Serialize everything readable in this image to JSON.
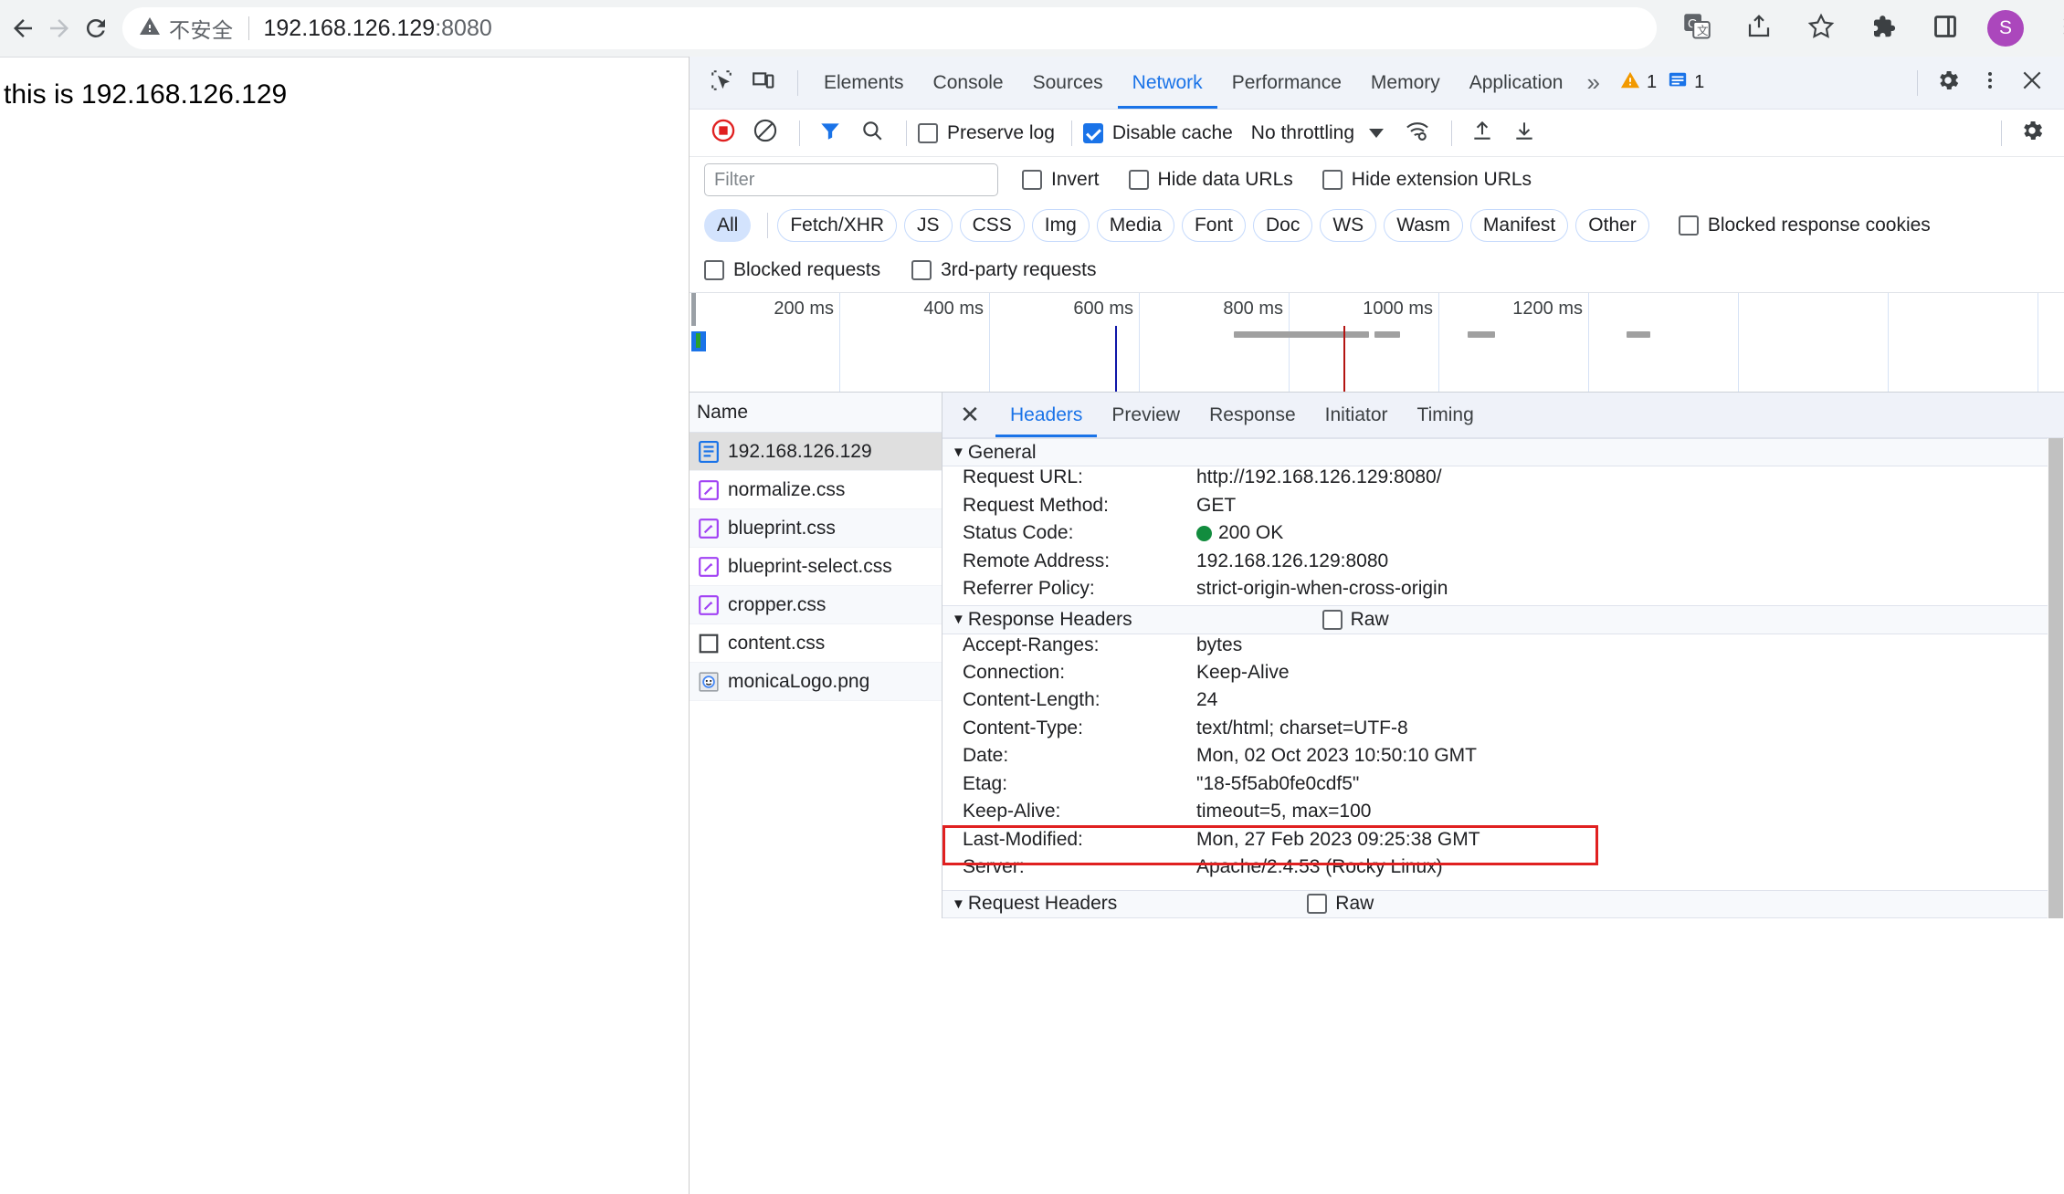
{
  "browser": {
    "back_icon": "back-arrow-icon",
    "forward_icon": "forward-arrow-icon",
    "reload_icon": "reload-icon",
    "security_label": "不安全",
    "url": "192.168.126.129",
    "url_port": ":8080",
    "actions": [
      "translate-icon",
      "share-icon",
      "bookmark-star-icon",
      "extensions-puzzle-icon",
      "side-panel-icon"
    ],
    "profile_initial": "S",
    "menu_icon": "three-dot-menu-icon"
  },
  "page": {
    "body_text": "this is 192.168.126.129"
  },
  "devtools": {
    "inspect_icon": "inspect-element-icon",
    "device_icon": "device-toolbar-icon",
    "tabs": [
      {
        "label": "Elements",
        "active": false
      },
      {
        "label": "Console",
        "active": false
      },
      {
        "label": "Sources",
        "active": false
      },
      {
        "label": "Network",
        "active": true
      },
      {
        "label": "Performance",
        "active": false
      },
      {
        "label": "Memory",
        "active": false
      },
      {
        "label": "Application",
        "active": false
      }
    ],
    "more_tabs": "»",
    "warning_count": "1",
    "message_count": "1",
    "settings_icon": "gear-icon",
    "dots_icon": "three-dot-menu-icon",
    "close_icon": "close-icon",
    "network_toolbar": {
      "record_icon": "record-stop-icon",
      "clear_icon": "clear-icon",
      "filter_icon": "filter-funnel-icon",
      "search_icon": "search-icon",
      "preserve_log": "Preserve log",
      "preserve_log_checked": false,
      "disable_cache": "Disable cache",
      "disable_cache_checked": true,
      "throttling": "No throttling",
      "wifi_icon": "network-conditions-icon",
      "import_icon": "import-har-icon",
      "export_icon": "export-har-icon",
      "settings_icon": "gear-icon"
    },
    "filter": {
      "placeholder": "Filter",
      "value": "",
      "invert": "Invert",
      "hide_data_urls": "Hide data URLs",
      "hide_extension_urls": "Hide extension URLs"
    },
    "type_filters": [
      {
        "label": "All",
        "selected": true
      },
      {
        "label": "Fetch/XHR",
        "selected": false
      },
      {
        "label": "JS",
        "selected": false
      },
      {
        "label": "CSS",
        "selected": false
      },
      {
        "label": "Img",
        "selected": false
      },
      {
        "label": "Media",
        "selected": false
      },
      {
        "label": "Font",
        "selected": false
      },
      {
        "label": "Doc",
        "selected": false
      },
      {
        "label": "WS",
        "selected": false
      },
      {
        "label": "Wasm",
        "selected": false
      },
      {
        "label": "Manifest",
        "selected": false
      },
      {
        "label": "Other",
        "selected": false
      }
    ],
    "blocked_response_cookies": "Blocked response cookies",
    "blocked_requests": "Blocked requests",
    "third_party_requests": "3rd-party requests",
    "overview": {
      "ticks": [
        "200 ms",
        "400 ms",
        "600 ms",
        "800 ms",
        "1000 ms",
        "1200 ms"
      ]
    },
    "request_list": {
      "column_header": "Name",
      "rows": [
        {
          "name": "192.168.126.129",
          "icon": "document-icon",
          "selected": true
        },
        {
          "name": "normalize.css",
          "icon": "stylesheet-icon",
          "selected": false
        },
        {
          "name": "blueprint.css",
          "icon": "stylesheet-icon",
          "selected": false
        },
        {
          "name": "blueprint-select.css",
          "icon": "stylesheet-icon",
          "selected": false
        },
        {
          "name": "cropper.css",
          "icon": "stylesheet-icon",
          "selected": false
        },
        {
          "name": "content.css",
          "icon": "generic-file-icon",
          "selected": false
        },
        {
          "name": "monicaLogo.png",
          "icon": "image-icon",
          "selected": false
        }
      ]
    },
    "detail": {
      "close_label": "✕",
      "tabs": [
        {
          "label": "Headers",
          "active": true
        },
        {
          "label": "Preview",
          "active": false
        },
        {
          "label": "Response",
          "active": false
        },
        {
          "label": "Initiator",
          "active": false
        },
        {
          "label": "Timing",
          "active": false
        }
      ],
      "sections": [
        {
          "title": "General",
          "raw": null,
          "rows": [
            {
              "key": "Request URL:",
              "value": "http://192.168.126.129:8080/"
            },
            {
              "key": "Request Method:",
              "value": "GET"
            },
            {
              "key": "Status Code:",
              "value": "200 OK",
              "status_dot": "#128c3e"
            },
            {
              "key": "Remote Address:",
              "value": "192.168.126.129:8080"
            },
            {
              "key": "Referrer Policy:",
              "value": "strict-origin-when-cross-origin"
            }
          ]
        },
        {
          "title": "Response Headers",
          "raw": "Raw",
          "rows": [
            {
              "key": "Accept-Ranges:",
              "value": "bytes"
            },
            {
              "key": "Connection:",
              "value": "Keep-Alive"
            },
            {
              "key": "Content-Length:",
              "value": "24"
            },
            {
              "key": "Content-Type:",
              "value": "text/html; charset=UTF-8"
            },
            {
              "key": "Date:",
              "value": "Mon, 02 Oct 2023 10:50:10 GMT"
            },
            {
              "key": "Etag:",
              "value": "\"18-5f5ab0fe0cdf5\""
            },
            {
              "key": "Keep-Alive:",
              "value": "timeout=5, max=100"
            },
            {
              "key": "Last-Modified:",
              "value": "Mon, 27 Feb 2023 09:25:38 GMT"
            },
            {
              "key": "Server:",
              "value": "Apache/2.4.53 (Rocky Linux)",
              "highlighted": true
            }
          ]
        },
        {
          "title": "Request Headers",
          "raw": "Raw",
          "rows": []
        }
      ],
      "highlight_color": "#e02020"
    }
  }
}
